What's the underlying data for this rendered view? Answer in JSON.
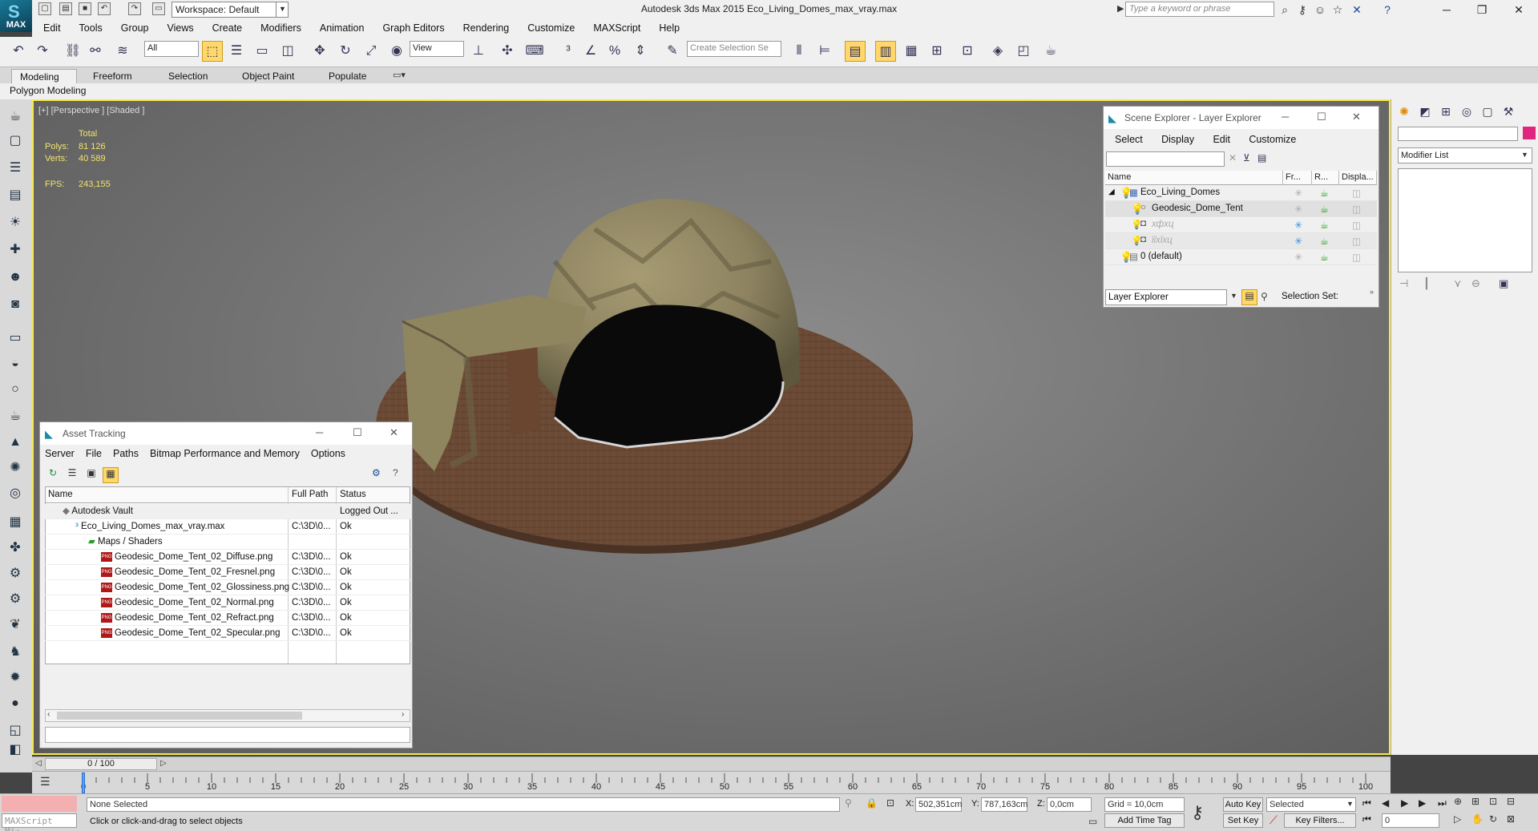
{
  "app": {
    "logo_text": "MAX",
    "window_title": "Autodesk 3ds Max  2015     Eco_Living_Domes_max_vray.max",
    "workspace": "Workspace: Default",
    "search_placeholder": "Type a keyword or phrase"
  },
  "menu": [
    "Edit",
    "Tools",
    "Group",
    "Views",
    "Create",
    "Modifiers",
    "Animation",
    "Graph Editors",
    "Rendering",
    "Customize",
    "MAXScript",
    "Help"
  ],
  "toolbar": {
    "selection_filter": "All",
    "ref_coord": "View",
    "named_selection_placeholder": "Create Selection Se"
  },
  "ribbon": {
    "tabs": [
      "Modeling",
      "Freeform",
      "Selection",
      "Object Paint",
      "Populate"
    ],
    "active_tab": "Modeling",
    "panel_label": "Polygon Modeling"
  },
  "viewport": {
    "label": "[+] [Perspective ] [Shaded ]",
    "stats": {
      "total_label": "Total",
      "polys_label": "Polys:",
      "polys": "81 126",
      "verts_label": "Verts:",
      "verts": "40 589",
      "fps_label": "FPS:",
      "fps": "243,155"
    }
  },
  "scene_explorer": {
    "title": "Scene Explorer - Layer Explorer",
    "menu": [
      "Select",
      "Display",
      "Edit",
      "Customize"
    ],
    "columns": [
      "Name",
      "Fr...",
      "R...",
      "Displa..."
    ],
    "rows": [
      {
        "name": "Eco_Living_Domes",
        "indent": 0
      },
      {
        "name": "Geodesic_Dome_Tent",
        "indent": 1
      },
      {
        "name": "хфхц",
        "indent": 1
      },
      {
        "name": "їїхїхц",
        "indent": 1
      },
      {
        "name": "0 (default)",
        "indent": 0
      }
    ],
    "explorer_type": "Layer Explorer",
    "selection_set_label": "Selection Set:"
  },
  "command_panel": {
    "modifier_list": "Modifier List",
    "accent_color": "#e0257d"
  },
  "asset_tracking": {
    "title": "Asset Tracking",
    "menu": [
      "Server",
      "File",
      "Paths",
      "Bitmap Performance and Memory",
      "Options"
    ],
    "columns": [
      "Name",
      "Full Path",
      "Status"
    ],
    "rows": [
      {
        "name": "Autodesk Vault",
        "path": "",
        "status": "Logged Out ...",
        "indent": 1,
        "icon": "vault"
      },
      {
        "name": "Eco_Living_Domes_max_vray.max",
        "path": "C:\\3D\\0...",
        "status": "Ok",
        "indent": 2,
        "icon": "max"
      },
      {
        "name": "Maps / Shaders",
        "path": "",
        "status": "",
        "indent": 3,
        "icon": "folder"
      },
      {
        "name": "Geodesic_Dome_Tent_02_Diffuse.png",
        "path": "C:\\3D\\0...",
        "status": "Ok",
        "indent": 4,
        "icon": "png"
      },
      {
        "name": "Geodesic_Dome_Tent_02_Fresnel.png",
        "path": "C:\\3D\\0...",
        "status": "Ok",
        "indent": 4,
        "icon": "png"
      },
      {
        "name": "Geodesic_Dome_Tent_02_Glossiness.png",
        "path": "C:\\3D\\0...",
        "status": "Ok",
        "indent": 4,
        "icon": "png"
      },
      {
        "name": "Geodesic_Dome_Tent_02_Normal.png",
        "path": "C:\\3D\\0...",
        "status": "Ok",
        "indent": 4,
        "icon": "png"
      },
      {
        "name": "Geodesic_Dome_Tent_02_Refract.png",
        "path": "C:\\3D\\0...",
        "status": "Ok",
        "indent": 4,
        "icon": "png"
      },
      {
        "name": "Geodesic_Dome_Tent_02_Specular.png",
        "path": "C:\\3D\\0...",
        "status": "Ok",
        "indent": 4,
        "icon": "png"
      }
    ]
  },
  "timeline": {
    "frame_display": "0 / 100",
    "ticks": [
      "0",
      "5",
      "10",
      "15",
      "20",
      "25",
      "30",
      "35",
      "40",
      "45",
      "50",
      "55",
      "60",
      "65",
      "70",
      "75",
      "80",
      "85",
      "90",
      "95",
      "100"
    ],
    "current_frame": 0,
    "frame_range": [
      0,
      100
    ]
  },
  "status": {
    "maxscript": "MAXScript Mi:",
    "selection": "None Selected",
    "prompt": "Click or click-and-drag to select objects",
    "x_label": "X:",
    "x": "502,351cm",
    "y_label": "Y:",
    "y": "787,163cm",
    "z_label": "Z:",
    "z": "0,0cm",
    "grid": "Grid = 10,0cm",
    "add_time_tag": "Add Time Tag",
    "auto_key": "Auto Key",
    "set_key": "Set Key",
    "key_mode": "Selected",
    "key_filters": "Key Filters...",
    "frame_field": "0"
  }
}
